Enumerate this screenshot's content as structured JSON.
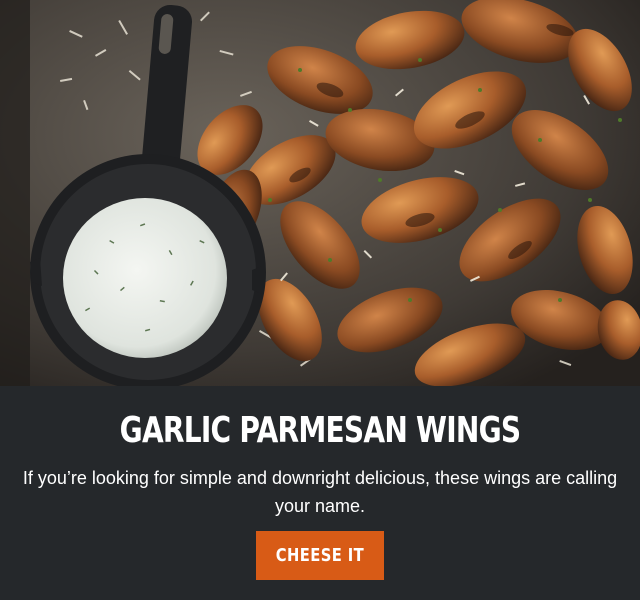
{
  "promo": {
    "image_subject": "wings-photo",
    "title": "GARLIC PARMESAN WINGS",
    "description": "If you’re looking for simple and downright delicious, these wings are calling your name.",
    "button_label": "CHEESE IT"
  },
  "colors": {
    "background": "#25282b",
    "accent": "#d85b16",
    "text": "#ffffff"
  }
}
